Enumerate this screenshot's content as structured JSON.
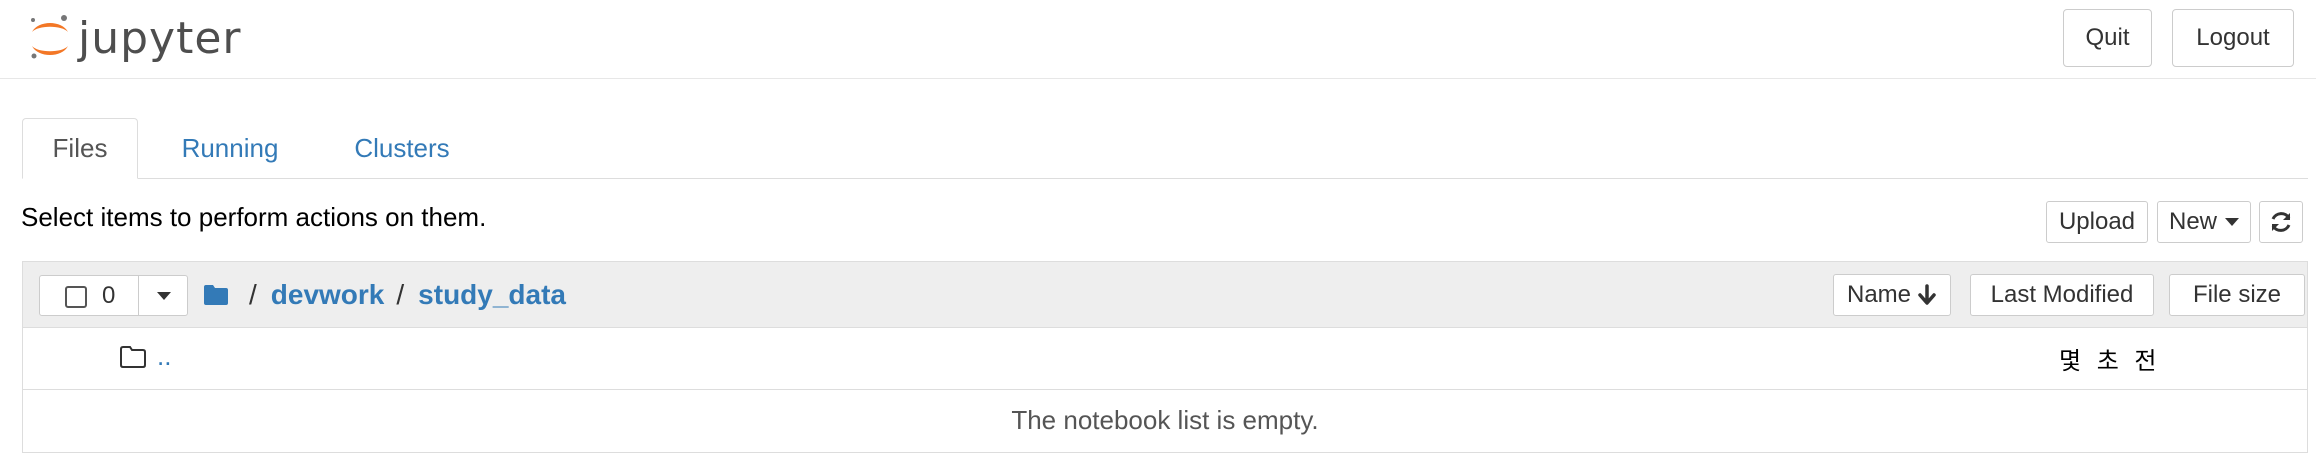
{
  "header": {
    "logo_text": "jupyter",
    "quit_label": "Quit",
    "logout_label": "Logout"
  },
  "tabs": [
    {
      "label": "Files",
      "active": true
    },
    {
      "label": "Running",
      "active": false
    },
    {
      "label": "Clusters",
      "active": false
    }
  ],
  "toolbar": {
    "instructions": "Select items to perform actions on them.",
    "upload_label": "Upload",
    "new_label": "New",
    "refresh_icon": "refresh-icon"
  },
  "list": {
    "selected_count": "0",
    "breadcrumb": [
      {
        "label": "/",
        "type": "separator"
      },
      {
        "label": "devwork",
        "type": "link"
      },
      {
        "label": "/",
        "type": "separator"
      },
      {
        "label": "study_data",
        "type": "link"
      }
    ],
    "sort_buttons": {
      "name": "Name",
      "last_modified": "Last Modified",
      "file_size": "File size"
    },
    "rows": [
      {
        "name": "..",
        "modified": "몇 초 전",
        "icon": "folder-outline-icon"
      }
    ],
    "empty_message": "The notebook list is empty."
  },
  "colors": {
    "link": "#337ab7",
    "logo_orange": "#f37726",
    "header_bg": "#eeeeee"
  }
}
